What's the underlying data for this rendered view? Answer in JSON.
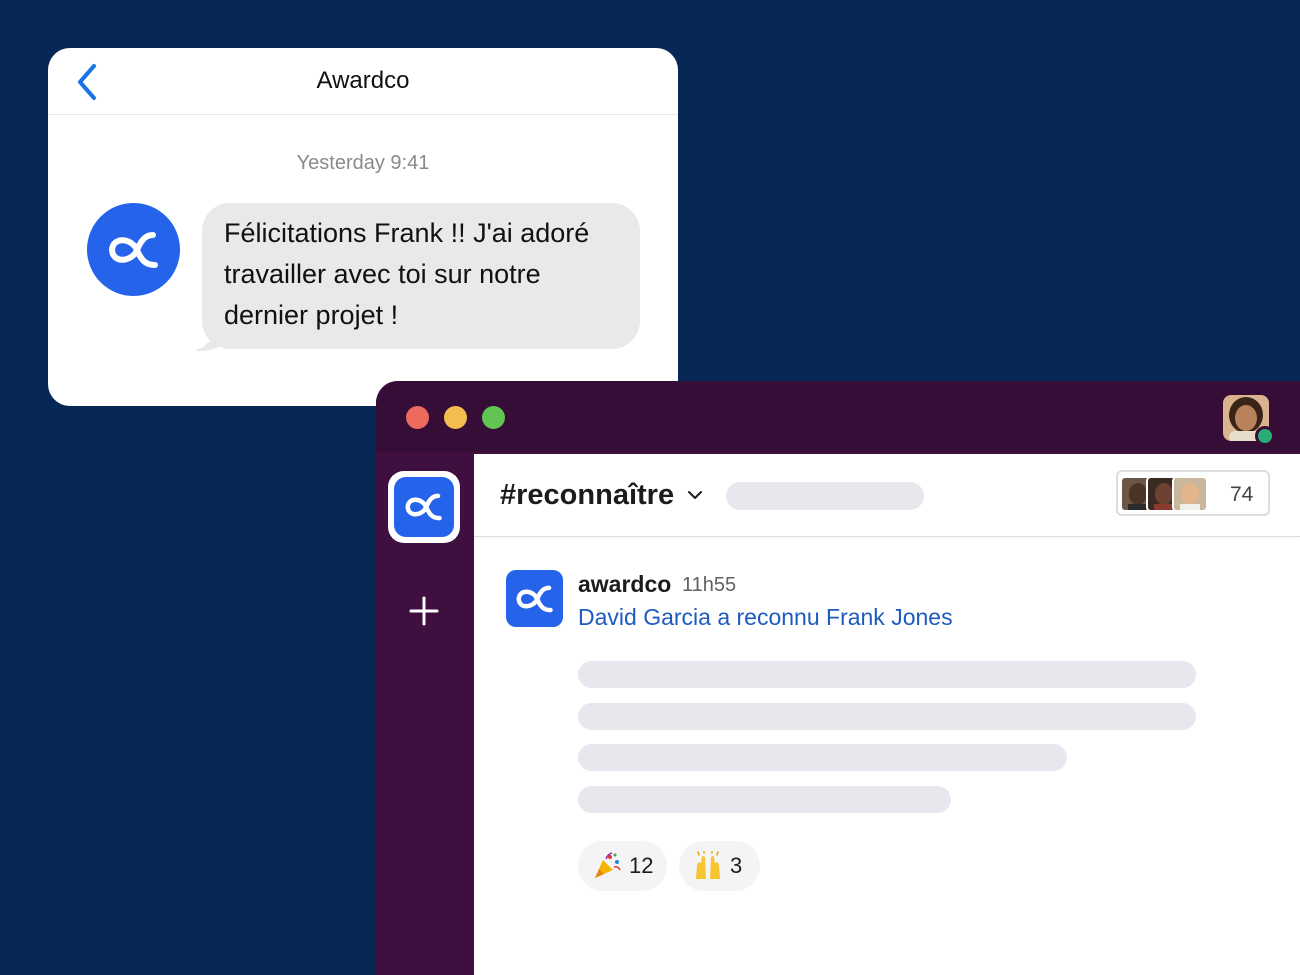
{
  "sms": {
    "title": "Awardco",
    "timestamp": "Yesterday 9:41",
    "message": "Félicitations Frank !! J'ai adoré travailler avec toi sur notre dernier projet !"
  },
  "slack": {
    "channel": {
      "name": "#reconnaître",
      "member_count": "74"
    },
    "message": {
      "author": "awardco",
      "time": "11h55",
      "headline": "David Garcia a reconnu Frank Jones"
    },
    "reactions": [
      {
        "emoji": "party-popper",
        "count": "12"
      },
      {
        "emoji": "raising-hands",
        "count": "3"
      }
    ]
  },
  "colors": {
    "background": "#072754",
    "brand_blue": "#2563eb",
    "slack_aubergine": "#3f0f3f",
    "slack_titlebar": "#350d36",
    "link_blue": "#1d5bbf",
    "presence_green": "#2bac76"
  }
}
